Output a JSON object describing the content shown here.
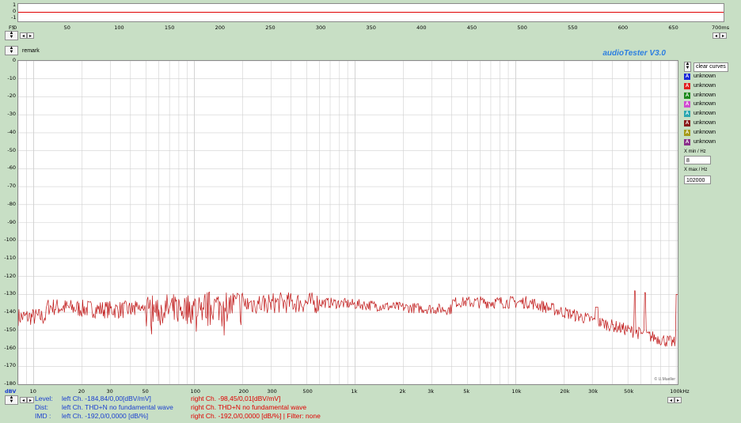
{
  "top_scope": {
    "y_ticks": [
      "1",
      "0",
      "-1"
    ],
    "x_prefix": "FS",
    "x_ticks": [
      "0",
      "50",
      "100",
      "150",
      "200",
      "250",
      "300",
      "350",
      "400",
      "450",
      "500",
      "550",
      "600",
      "650",
      "700ms"
    ]
  },
  "remark_label": "remark",
  "brand": "audioTester  V3.0",
  "main_plot": {
    "y_unit_label": "dBV",
    "y_ticks": [
      "0",
      "-10",
      "-20",
      "-30",
      "-40",
      "-50",
      "-60",
      "-70",
      "-80",
      "-90",
      "-100",
      "-110",
      "-120",
      "-130",
      "-140",
      "-150",
      "-160",
      "-170",
      "-180"
    ],
    "x_ticks": [
      "10",
      "20",
      "30",
      "50",
      "100",
      "200",
      "300",
      "500",
      "1k",
      "2k",
      "3k",
      "5k",
      "10k",
      "20k",
      "30k",
      "50k",
      "100kHz"
    ],
    "watermark": "© U.Mueller"
  },
  "legend": {
    "clear_label": "clear curves",
    "items": [
      {
        "badge": "A",
        "label": "unknown",
        "color": "#1c2bd8"
      },
      {
        "badge": "A",
        "label": "unknown",
        "color": "#e02020"
      },
      {
        "badge": "A",
        "label": "unknown",
        "color": "#1e8a1e"
      },
      {
        "badge": "A",
        "label": "unknown",
        "color": "#d04ad0"
      },
      {
        "badge": "A",
        "label": "unknown",
        "color": "#2aa7b0"
      },
      {
        "badge": "A",
        "label": "unknown",
        "color": "#8a1a1a"
      },
      {
        "badge": "A",
        "label": "unknown",
        "color": "#a59a1a"
      },
      {
        "badge": "A",
        "label": "unknown",
        "color": "#8a2f8a"
      }
    ]
  },
  "x_min_label": "X min / Hz",
  "x_min_value": "8",
  "x_max_label": "X max / Hz",
  "x_max_value": "102000",
  "status": {
    "level_label": "Level:",
    "level_left": "left Ch. -184,84/0,00[dBV/mV]",
    "level_right": "right Ch. -98,45/0,01[dBV/mV]",
    "dist_label": "Dist:",
    "dist_left": "left Ch. THD+N  no fundamental wave",
    "dist_right": "right Ch. THD+N  no fundamental wave",
    "imd_label": "IMD :",
    "imd_left": "left Ch. -192,0/0,0000 [dB/%]",
    "imd_right": "right Ch. -192,0/0,0000 [dB/%] |   Filter: none"
  },
  "colors": {
    "trace": "#c01818",
    "scope_line": "#e00000",
    "grid": "#d0d0d0"
  }
}
